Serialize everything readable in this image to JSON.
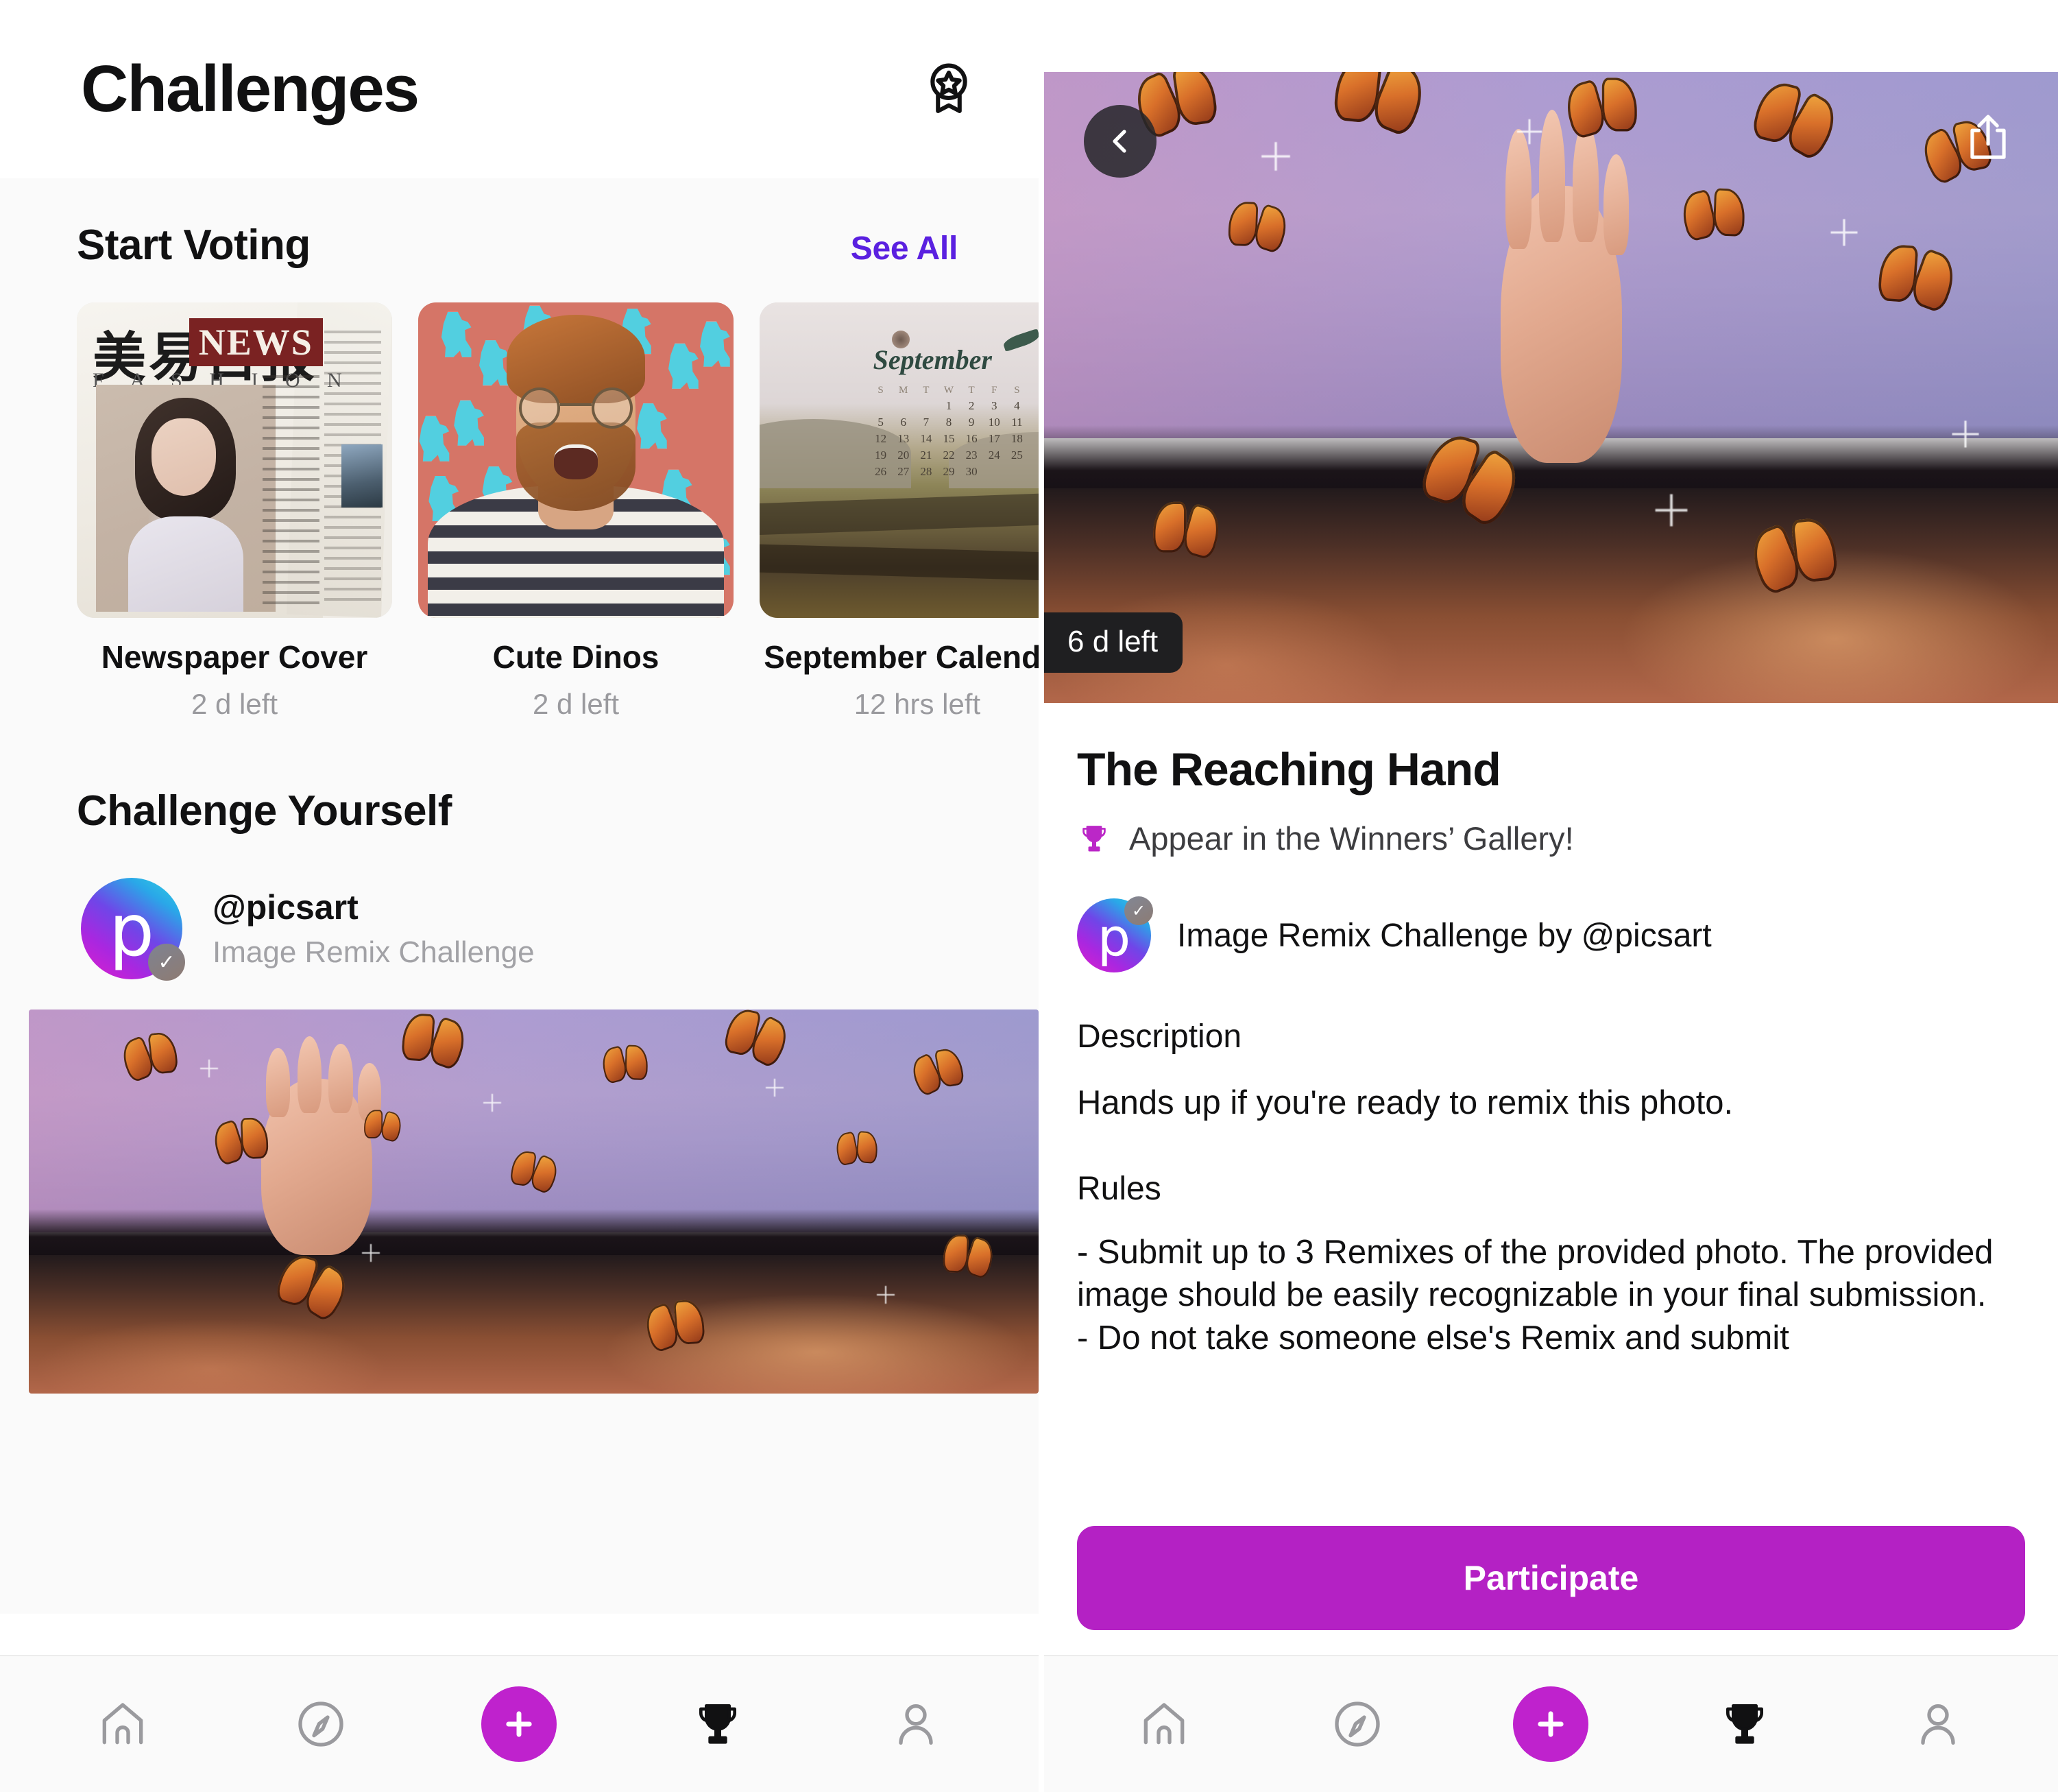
{
  "left": {
    "header": {
      "title": "Challenges",
      "award_icon": "award-badge-icon"
    },
    "voting": {
      "section_title": "Start Voting",
      "see_all": "See All",
      "cards": [
        {
          "title": "Newspaper Cover",
          "time_left": "2 d left",
          "thumb": {
            "cjk": "美易日报",
            "news": "NEWS",
            "fashion": "F A S H I O N"
          }
        },
        {
          "title": "Cute Dinos",
          "time_left": "2 d left"
        },
        {
          "title": "September Calendar",
          "time_left": "12 hrs left",
          "thumb": {
            "month": "September",
            "dow": [
              "S",
              "M",
              "T",
              "W",
              "T",
              "F",
              "S"
            ],
            "days": [
              "",
              "",
              "",
              "1",
              "2",
              "3",
              "4",
              "5",
              "6",
              "7",
              "8",
              "9",
              "10",
              "11",
              "12",
              "13",
              "14",
              "15",
              "16",
              "17",
              "18",
              "19",
              "20",
              "21",
              "22",
              "23",
              "24",
              "25",
              "26",
              "27",
              "28",
              "29",
              "30"
            ]
          }
        }
      ]
    },
    "challenge_yourself": {
      "section_title": "Challenge Yourself",
      "author_handle": "@picsart",
      "author_sub": "Image Remix Challenge",
      "avatar_letter": "p",
      "verified_check": "✓"
    },
    "tabbar": {
      "items": [
        {
          "name": "home",
          "active": false
        },
        {
          "name": "discover",
          "active": false
        },
        {
          "name": "create",
          "active": true
        },
        {
          "name": "challenges",
          "active": true
        },
        {
          "name": "profile",
          "active": false
        }
      ]
    }
  },
  "right": {
    "back_icon": "chevron-left-icon",
    "share_icon": "share-icon",
    "time_badge": "6 d left",
    "title": "The Reaching Hand",
    "prize": "Appear in the Winners’ Gallery!",
    "prize_icon": "trophy-icon",
    "author_line": "Image Remix Challenge by @picsart",
    "avatar_letter": "p",
    "verified_check": "✓",
    "description_heading": "Description",
    "description_body": "Hands up if you're ready to remix this photo.",
    "rules_heading": "Rules",
    "rules_body": "- Submit up to 3 Remixes of the provided photo. The provided image should be easily recognizable in your final submission.\n- Do not take someone else's Remix and submit",
    "participate_label": "Participate"
  },
  "colors": {
    "accent_magenta": "#b421c4",
    "fab_magenta": "#bf22cd",
    "link_violet": "#5a20e0",
    "trophy": "#bb27c7",
    "badge_dark": "#1f1f21"
  }
}
